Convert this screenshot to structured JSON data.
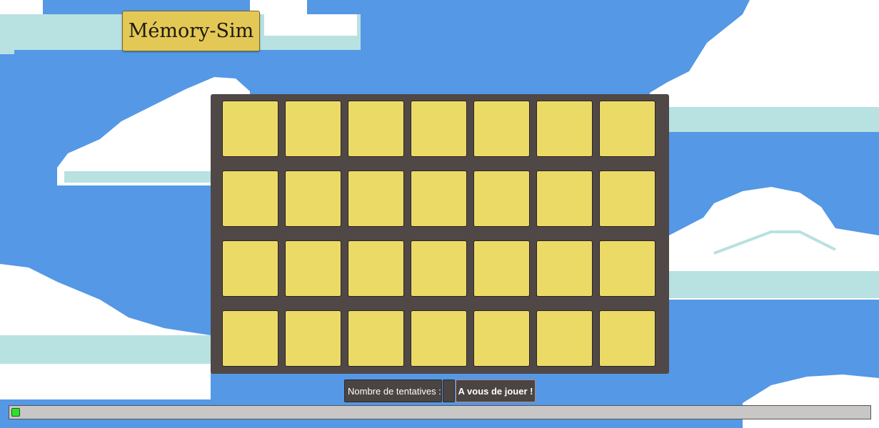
{
  "app": {
    "title": "Mémory-Sim"
  },
  "board": {
    "rows": 4,
    "columns": 7,
    "card_face": "hidden",
    "card_color": "#ecda67",
    "board_color": "#504847"
  },
  "status_bar": {
    "tries_label": "Nombre de tentatives :",
    "tries_count": "",
    "play_button_label": "A vous de jouer !"
  },
  "timer": {
    "progress": 0.01,
    "fill_color": "#2ee02e"
  },
  "background": {
    "sky_color": "#5498e6",
    "cloud_color": "#ffffff",
    "cloud_shadow_color": "#b8e1e1"
  }
}
